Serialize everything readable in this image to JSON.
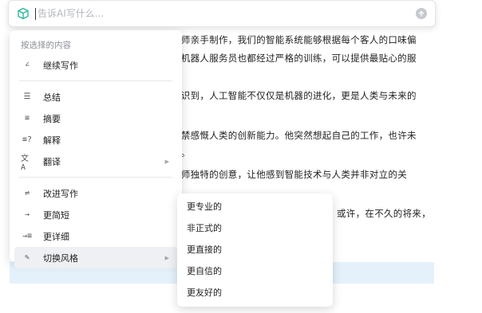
{
  "ai_bar": {
    "placeholder": "告诉AI写什么...",
    "logo_icon": "ai-cube-icon",
    "send_icon": "arrow-up-icon",
    "accent": "#2bb89a"
  },
  "document": {
    "lines": [
      "厨师亲手制作，我们的智能系统能够根据每个客人的口味偏",
      "的机器人服务员也都经过严格的训练，可以提供最贴心的服",
      "意识到，人工智能不仅仅是机器的进化，更是人类与未来的",
      "不禁感慨人类的创新能力。他突然想起自己的工作，也许未",
      "吧。",
      "厨师独特的创意，让他感到智能技术与人类并非对立的关",
      "或许，在不久的将来，"
    ],
    "highlight_color": "#e4f1fb"
  },
  "menu": {
    "caption": "按选择的内容",
    "groups": [
      [
        {
          "label": "继续写作",
          "icon": "pen-icon",
          "glyph": "∠"
        }
      ],
      [
        {
          "label": "总结",
          "icon": "summary-icon",
          "glyph": "☰"
        },
        {
          "label": "摘要",
          "icon": "abstract-icon",
          "glyph": "≡"
        },
        {
          "label": "解释",
          "icon": "explain-icon",
          "glyph": "≡?"
        },
        {
          "label": "翻译",
          "icon": "translate-icon",
          "glyph": "文A",
          "has_submenu": true
        }
      ],
      [
        {
          "label": "改进写作",
          "icon": "improve-icon",
          "glyph": "⇌"
        },
        {
          "label": "更简短",
          "icon": "shorter-icon",
          "glyph": "→"
        },
        {
          "label": "更详细",
          "icon": "longer-icon",
          "glyph": "→≡"
        },
        {
          "label": "切换风格",
          "icon": "paintbrush-icon",
          "glyph": "✎",
          "has_submenu": true,
          "active": true
        }
      ]
    ],
    "submenu_arrow": "▶"
  },
  "style_submenu": {
    "items": [
      "更专业的",
      "非正式的",
      "更直接的",
      "更自信的",
      "更友好的"
    ]
  }
}
